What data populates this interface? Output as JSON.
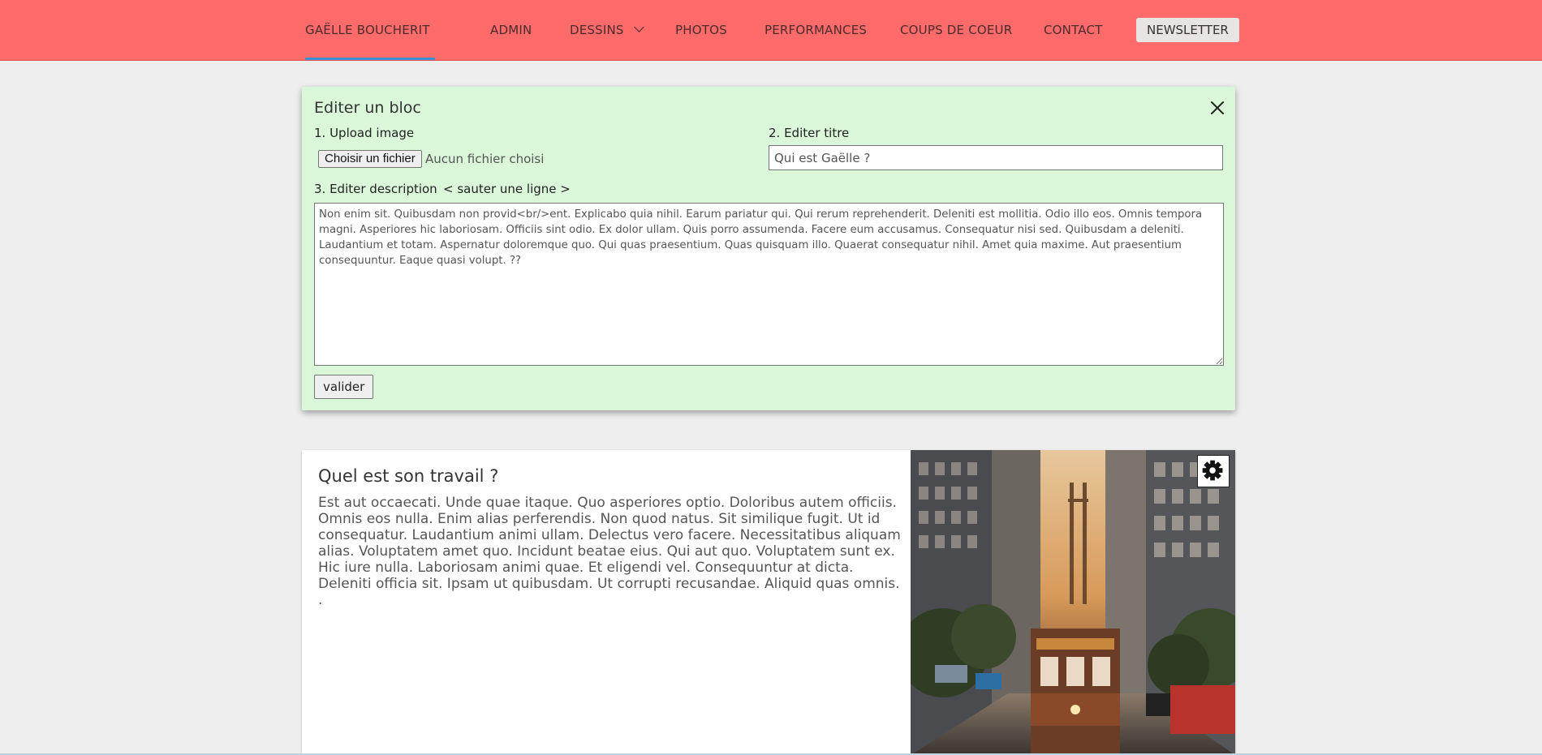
{
  "nav": {
    "brand": "GAËLLE BOUCHERIT",
    "items": [
      "ADMIN",
      "DESSINS",
      "PHOTOS",
      "PERFORMANCES",
      "COUPS DE COEUR",
      "CONTACT"
    ],
    "newsletter": "NEWSLETTER"
  },
  "editor": {
    "title": "Editer un bloc",
    "upload_label": "1. Upload image",
    "file_button": "Choisir un fichier",
    "file_status": "Aucun fichier choisi",
    "title_label": "2. Editer titre",
    "title_value": "Qui est Gaëlle ?",
    "desc_label": "3. Editer description",
    "desc_hint": "< sauter une ligne >",
    "desc_value": "Non enim sit. Quibusdam non provid<br/>ent. Explicabo quia nihil. Earum pariatur qui. Qui rerum reprehenderit. Deleniti est mollitia. Odio illo eos. Omnis tempora magni. Asperiores hic laboriosam. Officiis sint odio. Ex dolor ullam. Quis porro assumenda. Facere eum accusamus. Consequatur nisi sed. Quibusdam a deleniti. Laudantium et totam. Aspernatur doloremque quo. Qui quas praesentium. Quas quisquam illo. Quaerat consequatur nihil. Amet quia maxime. Aut praesentium consequuntur. Eaque quasi volupt. ??",
    "submit": "valider"
  },
  "block": {
    "title": "Quel est son travail ?",
    "text": "Est aut occaecati. Unde quae itaque. Quo asperiores optio. Doloribus autem officiis. Omnis eos nulla. Enim alias perferendis. Non quod natus. Sit similique fugit. Ut id consequatur. Laudantium animi ullam. Delectus vero facere. Necessitatibus aliquam alias. Voluptatem amet quo. Incidunt beatae eius. Qui aut quo. Voluptatem sunt ex. Hic iure nulla. Laboriosam animi quae. Et eligendi vel. Consequuntur at dicta. Deleniti officia sit. Ipsam ut quibusdam. Ut corrupti recusandae. Aliquid quas omnis. ."
  },
  "colors": {
    "nav_bg": "#ff6b6b",
    "editor_bg": "#dbf7da",
    "page_bg": "#eeeeee",
    "active_underline": "#3f8fd3"
  },
  "icons": {
    "close": "close-icon",
    "settings": "gear-icon",
    "dropdown": "chevron-down-icon"
  }
}
